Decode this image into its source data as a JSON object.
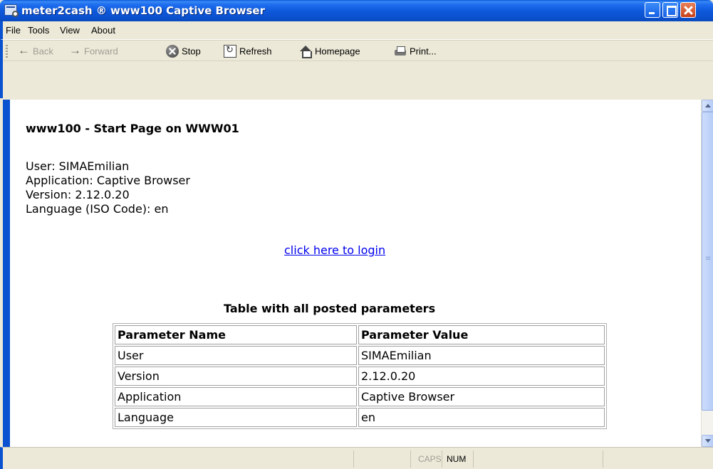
{
  "window": {
    "title": "meter2cash ® www100 Captive Browser",
    "icons": {
      "app": "browser-window-icon",
      "minimize": "minimize-icon",
      "maximize": "maximize-icon",
      "close": "close-icon"
    }
  },
  "menu": {
    "items": [
      "File",
      "Tools",
      "View",
      "About"
    ]
  },
  "toolbar": {
    "back": "Back",
    "forward": "Forward",
    "stop": "Stop",
    "refresh": "Refresh",
    "homepage": "Homepage",
    "print": "Print..."
  },
  "page": {
    "heading": "www100 - Start Page on WWW01",
    "info": {
      "user": "User: SIMAEmilian",
      "application": "Application: Captive Browser",
      "version": "Version: 2.12.0.20",
      "language": "Language (ISO Code): en"
    },
    "login_link": "click here to login",
    "table_caption": "Table with all posted parameters",
    "table": {
      "headers": [
        "Parameter Name",
        "Parameter Value"
      ],
      "rows": [
        [
          "User",
          "SIMAEmilian"
        ],
        [
          "Version",
          "2.12.0.20"
        ],
        [
          "Application",
          "Captive Browser"
        ],
        [
          "Language",
          "en"
        ]
      ]
    }
  },
  "statusbar": {
    "caps": "CAPS",
    "num": "NUM"
  },
  "colors": {
    "titlebar": "#0b52d0",
    "chrome": "#ece9d8",
    "link": "#0000ee",
    "close_button": "#c8401a"
  }
}
